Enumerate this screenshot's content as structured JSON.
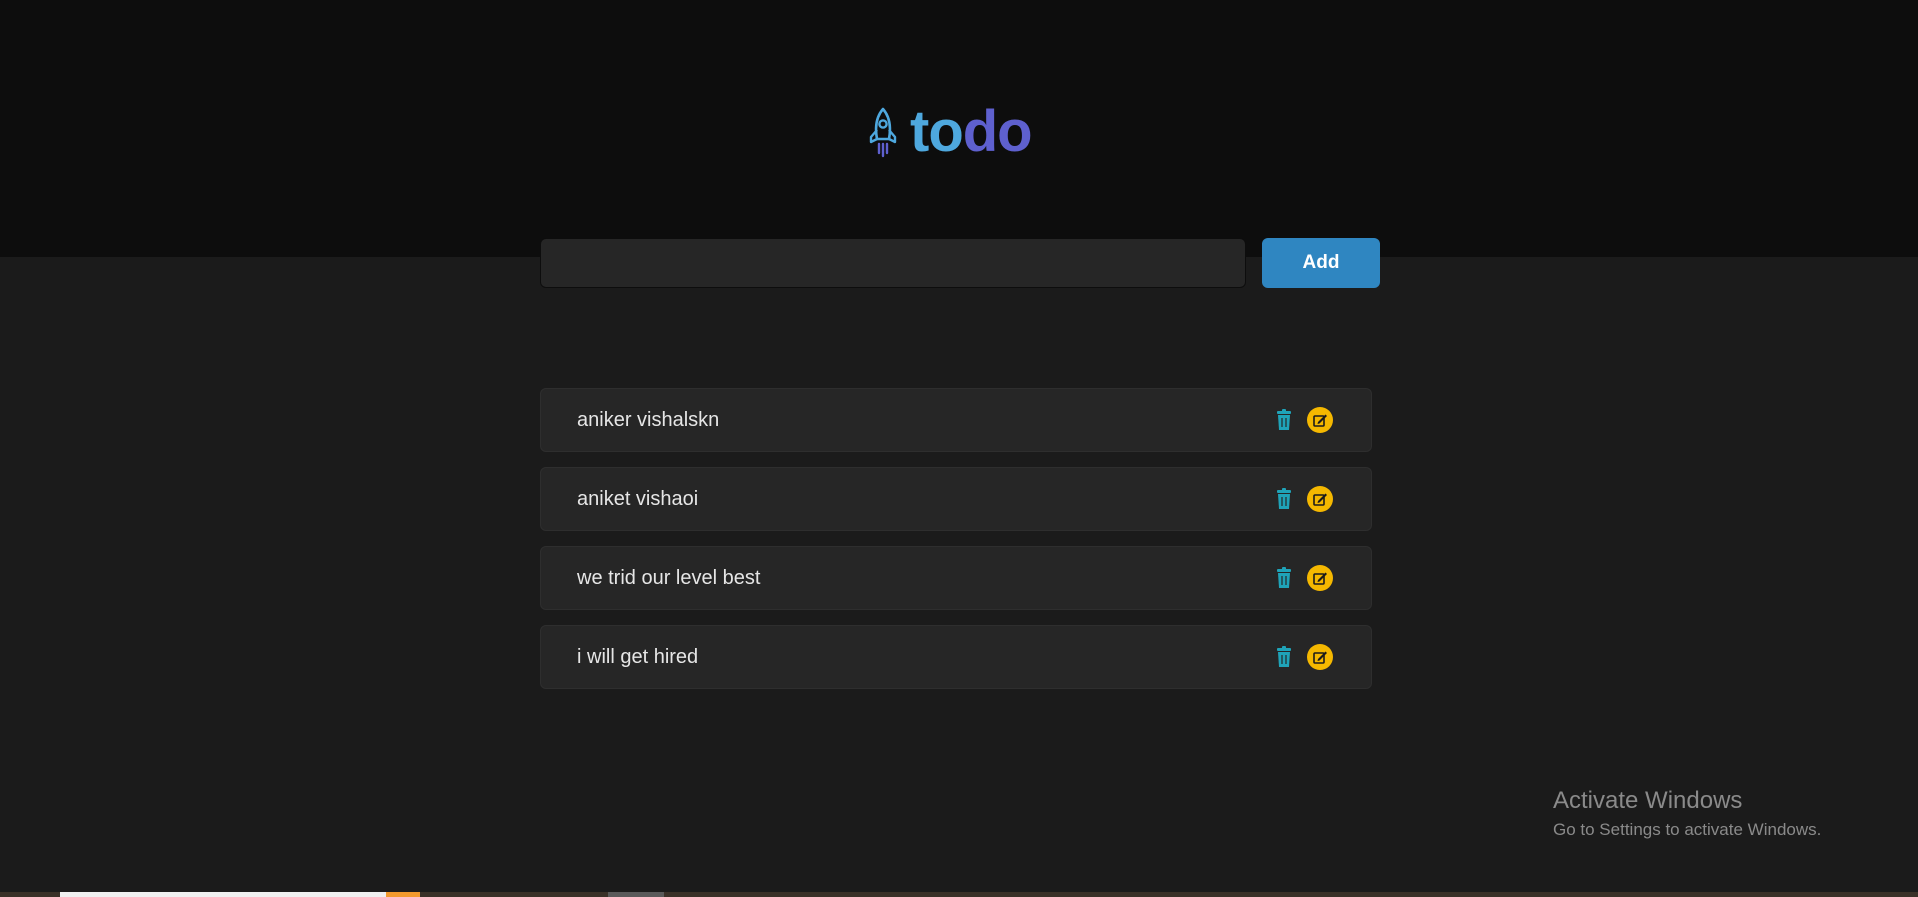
{
  "header": {
    "logo_part1": "to",
    "logo_part2": "do",
    "logo_icon": "rocket-icon",
    "colors": {
      "logo_to": "#4ea8de",
      "logo_do": "#5e60ce"
    }
  },
  "new_task": {
    "value": "",
    "placeholder": "",
    "add_label": "Add",
    "add_color": "#2f86c1"
  },
  "todos": [
    {
      "text": "aniker vishalskn",
      "delete_icon": "trash-icon",
      "edit_icon": "edit-icon"
    },
    {
      "text": "aniket vishaoi",
      "delete_icon": "trash-icon",
      "edit_icon": "edit-icon"
    },
    {
      "text": "we trid our level best",
      "delete_icon": "trash-icon",
      "edit_icon": "edit-icon"
    },
    {
      "text": "i will get hired",
      "delete_icon": "trash-icon",
      "edit_icon": "edit-icon"
    }
  ],
  "icon_colors": {
    "trash": "#1fa3b8",
    "edit": "#f5b800"
  },
  "watermark": {
    "title": "Activate Windows",
    "subtitle": "Go to Settings to activate Windows."
  }
}
